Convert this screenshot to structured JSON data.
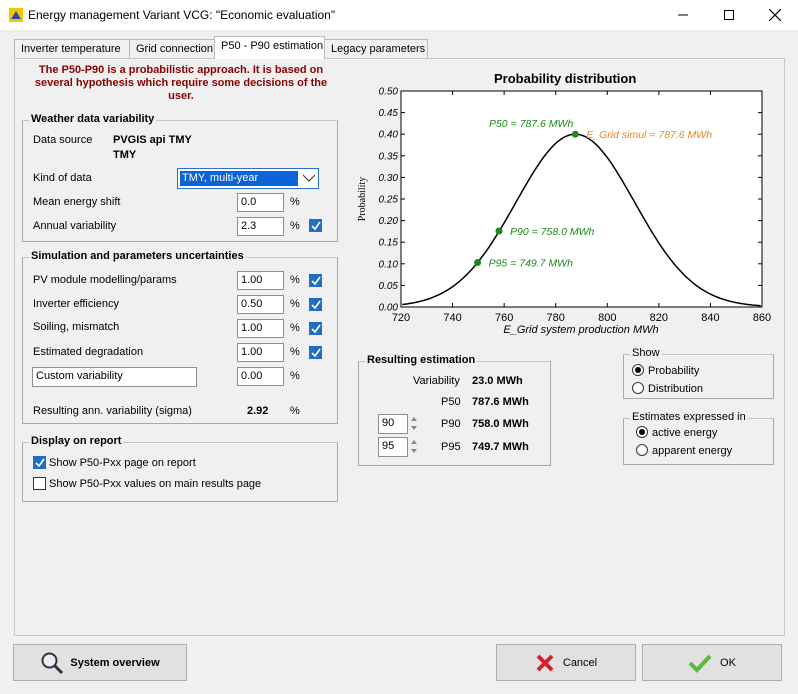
{
  "window": {
    "title": "Energy management Variant VCG:   \"Economic evaluation\""
  },
  "tabs": [
    {
      "label": "Inverter temperature"
    },
    {
      "label": "Grid connection"
    },
    {
      "label": "P50 - P90 estimation"
    },
    {
      "label": "Legacy parameters"
    }
  ],
  "intro_text": "The P50-P90 is a probabilistic approach. It is based on several hypothesis which require some decisions of the user.",
  "weather": {
    "title": "Weather data variability",
    "data_source_label": "Data source",
    "data_source_value1": "PVGIS api TMY",
    "data_source_value2": "TMY",
    "kind_label": "Kind of data",
    "kind_value": "TMY, multi-year",
    "mean_shift_label": "Mean energy shift",
    "mean_shift_value": "0.0",
    "mean_shift_unit": "%",
    "annual_var_label": "Annual variability",
    "annual_var_value": "2.3",
    "annual_var_unit": "%"
  },
  "uncertainties": {
    "title": "Simulation and parameters uncertainties",
    "rows": [
      {
        "label": "PV module modelling/params",
        "value": "1.00",
        "unit": "%"
      },
      {
        "label": "Inverter efficiency",
        "value": "0.50",
        "unit": "%"
      },
      {
        "label": "Soiling, mismatch",
        "value": "1.00",
        "unit": "%"
      },
      {
        "label": "Estimated degradation",
        "value": "1.00",
        "unit": "%"
      }
    ],
    "custom_label": "Custom variability",
    "custom_value": "0.00",
    "custom_unit": "%",
    "result_label": "Resulting ann. variability (sigma)",
    "result_value": "2.92",
    "result_unit": "%"
  },
  "report": {
    "title": "Display on report",
    "show_page_label": "Show P50-Pxx page on report",
    "show_values_label": "Show P50-Pxx values on main results page"
  },
  "chart_data": {
    "type": "line",
    "title": "Probability distribution",
    "xlabel": "E_Grid system production MWh",
    "ylabel": "Probability",
    "xlim": [
      720,
      860
    ],
    "ylim": [
      0,
      0.5
    ],
    "xticks": [
      720,
      740,
      760,
      780,
      800,
      820,
      840,
      860
    ],
    "yticks": [
      0.0,
      0.05,
      0.1,
      0.15,
      0.2,
      0.25,
      0.3,
      0.35,
      0.4,
      0.45,
      0.5
    ],
    "ytick_labels": [
      "0.00",
      "0.05",
      "0.10",
      "0.15",
      "0.20",
      "0.25",
      "0.30",
      "0.35",
      "0.40",
      "0.45",
      "0.50"
    ],
    "mean": 787.6,
    "sigma": 23.0,
    "peak": 0.4,
    "annotations": [
      {
        "label": "P50 = 787.6 MWh",
        "x": 787.6,
        "y": 0.4,
        "color": "#1a8a1a"
      },
      {
        "label": "E_Grid simul = 787.6 MWh",
        "x": 787.6,
        "y": 0.4,
        "color": "#e88a1a"
      },
      {
        "label": "P90 = 758.0 MWh",
        "x": 758.0,
        "y": 0.176,
        "color": "#1a8a1a"
      },
      {
        "label": "P95 = 749.7 MWh",
        "x": 749.7,
        "y": 0.103,
        "color": "#1a8a1a"
      }
    ]
  },
  "result": {
    "title": "Resulting estimation",
    "variability_label": "Variability",
    "variability_value": "23.0 MWh",
    "p50_label": "P50",
    "p50_value": "787.6 MWh",
    "p90_input": "90",
    "p90_label": "P90",
    "p90_value": "758.0 MWh",
    "p95_input": "95",
    "p95_label": "P95",
    "p95_value": "749.7 MWh"
  },
  "show": {
    "title": "Show",
    "opt1": "Probability",
    "opt2": "Distribution"
  },
  "estimates": {
    "title": "Estimates expressed in",
    "opt1": "active energy",
    "opt2": "apparent energy"
  },
  "buttons": {
    "overview": "System overview",
    "cancel": "Cancel",
    "ok": "OK"
  },
  "colors": {
    "accent": "#1f6fc5",
    "warning_text": "#8b0000",
    "p_marker": "#1a8a1a",
    "simul_marker": "#e88a1a"
  }
}
